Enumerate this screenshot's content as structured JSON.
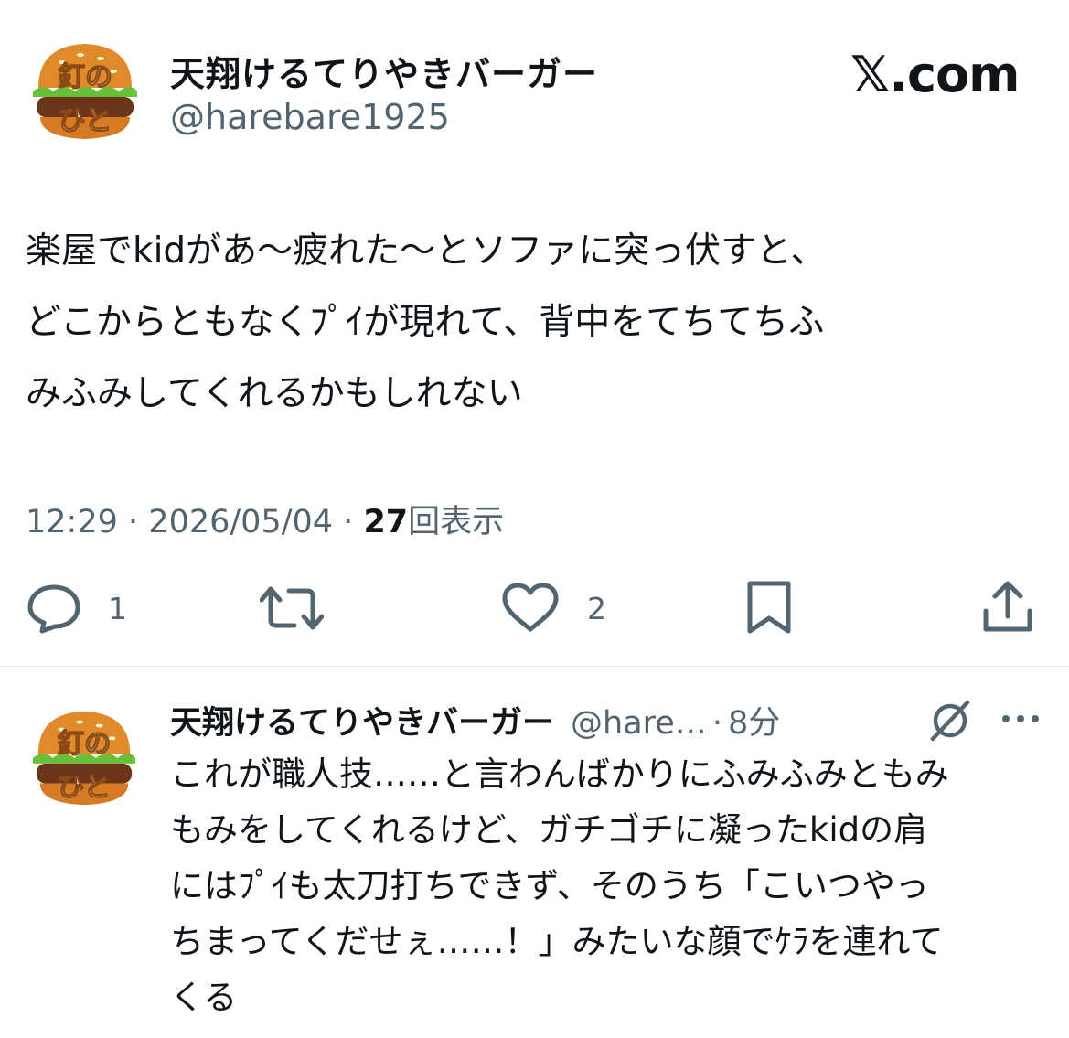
{
  "tweet": {
    "author": {
      "display_name": "天翔けるてりやきバーガー",
      "handle": "@harebare1925",
      "avatar_text": "釘のひと"
    },
    "site_logo": "𝕏.com",
    "text_lines": [
      "楽屋でkidがあ〜疲れた〜とソファに突っ伏すと、",
      "どこからともなくﾌﾟｲが現れて、背中をてちてちふ",
      "みふみしてくれるかもしれない"
    ],
    "time": "12:29",
    "date": "2026/05/04",
    "views_count": "27",
    "views_label": "回表示",
    "separator": "·",
    "actions": {
      "reply_count": "1",
      "like_count": "2"
    }
  },
  "reply": {
    "display_name": "天翔けるてりやきバーガー",
    "handle": "@hare…",
    "separator": "·",
    "time_ago": "8分",
    "text_lines": [
      "これが職人技……と言わんばかりにふみふみともみ",
      "もみをしてくれるけど、ガチゴチに凝ったkidの肩",
      "にはﾌﾟｲも太刀打ちできず、そのうち「こいつやっ",
      "ちまってくだせぇ……！」みたいな顔でｹﾗを連れて",
      "くる"
    ]
  }
}
